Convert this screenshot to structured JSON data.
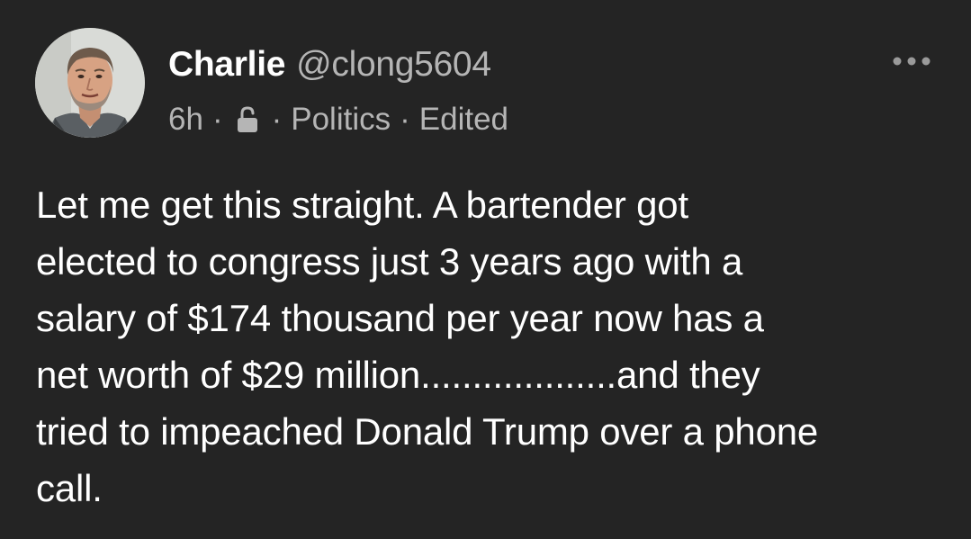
{
  "post": {
    "author": {
      "display_name": "Charlie",
      "handle": "@clong5604",
      "avatar_icon": "user-avatar-photo"
    },
    "meta": {
      "time": "6h",
      "separator": "·",
      "visibility_icon": "unlocked-padlock-icon",
      "category": "Politics",
      "edited_label": "Edited"
    },
    "more_icon": "more-horizontal-icon",
    "body_lines": [
      "Let me get this straight. A bartender got",
      "elected to congress just 3 years ago with a",
      "salary of $174 thousand per year now has a",
      "net worth of $29 million...................and they",
      "tried to impeached Donald Trump over a phone",
      "call."
    ]
  },
  "colors": {
    "background": "#242424",
    "primary_text": "#ffffff",
    "secondary_text": "#b5b5b5"
  }
}
